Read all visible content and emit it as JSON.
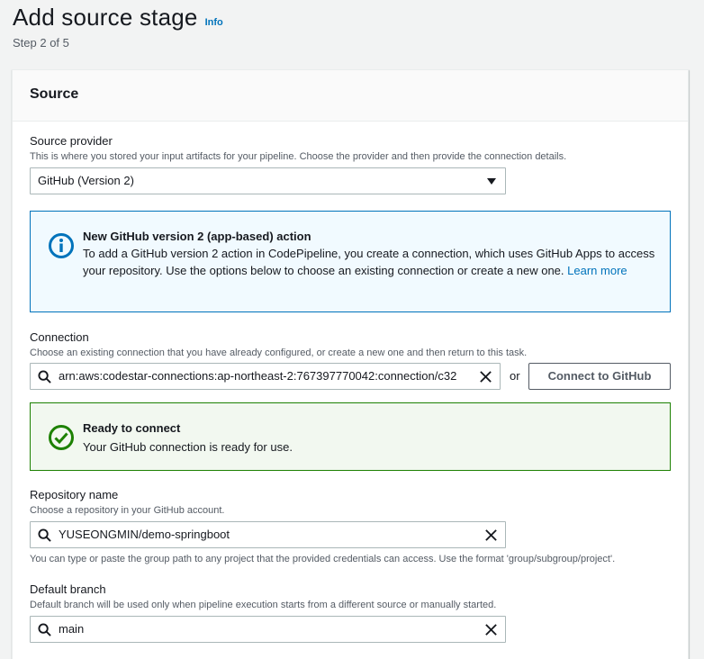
{
  "header": {
    "title": "Add source stage",
    "info_link": "Info",
    "step": "Step 2 of 5"
  },
  "panel": {
    "title": "Source"
  },
  "source_provider": {
    "label": "Source provider",
    "description": "This is where you stored your input artifacts for your pipeline. Choose the provider and then provide the connection details.",
    "selected": "GitHub (Version 2)"
  },
  "info_alert": {
    "title": "New GitHub version 2 (app-based) action",
    "body": "To add a GitHub version 2 action in CodePipeline, you create a connection, which uses GitHub Apps to access your repository. Use the options below to choose an existing connection or create a new one.",
    "link": "Learn more",
    "color": "#0073bb"
  },
  "connection": {
    "label": "Connection",
    "description": "Choose an existing connection that you have already configured, or create a new one and then return to this task.",
    "value": "arn:aws:codestar-connections:ap-northeast-2:767397770042:connection/c32",
    "or_text": "or",
    "connect_button": "Connect to GitHub"
  },
  "success_alert": {
    "title": "Ready to connect",
    "body": "Your GitHub connection is ready for use.",
    "color": "#1d8102"
  },
  "repository": {
    "label": "Repository name",
    "description": "Choose a repository in your GitHub account.",
    "value": "YUSEONGMIN/demo-springboot",
    "hint": "You can type or paste the group path to any project that the provided credentials can access. Use the format 'group/subgroup/project'."
  },
  "branch": {
    "label": "Default branch",
    "description": "Default branch will be used only when pipeline execution starts from a different source or manually started.",
    "value": "main"
  },
  "icons": {
    "info": "info-circle-icon",
    "success": "check-circle-icon",
    "search": "search-icon",
    "clear": "close-icon",
    "caret": "caret-down-icon"
  }
}
